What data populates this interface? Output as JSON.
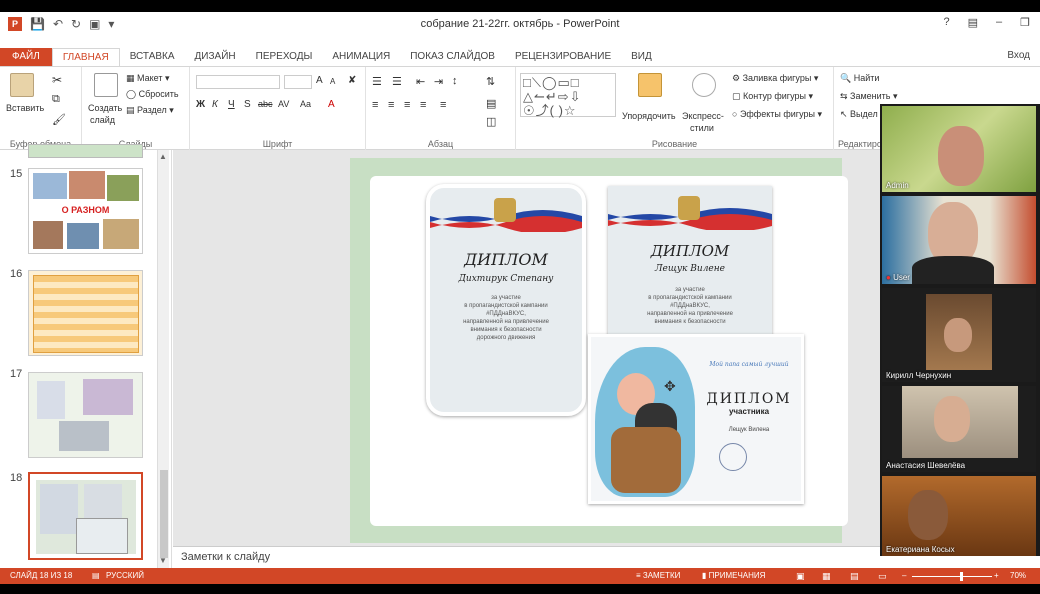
{
  "window": {
    "title": "собрание 21-22гг. октябрь - PowerPoint",
    "help": "?",
    "minimize": "–",
    "signin": "Вход"
  },
  "tabs": [
    "ФАЙЛ",
    "ГЛАВНАЯ",
    "ВСТАВКА",
    "ДИЗАЙН",
    "ПЕРЕХОДЫ",
    "АНИМАЦИЯ",
    "ПОКАЗ СЛАЙДОВ",
    "РЕЦЕНЗИРОВАНИЕ",
    "ВИД"
  ],
  "ribbon": {
    "paste": "Вставить",
    "create_slide": "Создать",
    "create_slide2": "слайд",
    "layout": "Макет",
    "reset": "Сбросить",
    "section": "Раздел",
    "font_bold": "Ж",
    "font_italic": "К",
    "font_underline": "Ч",
    "font_strike": "S",
    "font_abc": "abc",
    "font_av": "AV",
    "font_aa": "Aa",
    "font_a": "A",
    "font_grow": "A",
    "font_shrink": "A",
    "arrange": "Упорядочить",
    "express1": "Экспресс-",
    "express2": "стили",
    "fill": "Заливка фигуры",
    "outline": "Контур фигуры",
    "effects": "Эффекты фигуры",
    "find": "Найти",
    "replace": "Заменить",
    "select": "Выдел",
    "groups": {
      "clipboard": "Буфер обмена",
      "slides": "Слайды",
      "font": "Шрифт",
      "paragraph": "Абзац",
      "drawing": "Рисование",
      "editing": "Редактиро"
    }
  },
  "thumbnails": [
    {
      "num": "15",
      "caption": "О РАЗНОМ"
    },
    {
      "num": "16"
    },
    {
      "num": "17"
    },
    {
      "num": "18"
    }
  ],
  "slide": {
    "diploma1": {
      "title": "ДИПЛОМ",
      "name": "Дихтирук Степану",
      "lines": [
        "за участие",
        "в пропагандистской кампании",
        "#ПДДнаВКУС,",
        "направленной на привлечение",
        "внимания к безопасности",
        "дорожного движения"
      ]
    },
    "diploma2": {
      "title": "ДИПЛОМ",
      "name": "Лещук Вилене",
      "lines": [
        "за участие",
        "в пропагандистской кампании",
        "#ПДДнаВКУС,",
        "направленной на привлечение",
        "внимания к безопасности"
      ]
    },
    "diploma3": {
      "title": "ДИПЛОМ",
      "subtitle": "участника",
      "name": "Лещук Вилена",
      "tagline": "Мой папа самый лучший"
    }
  },
  "notes_placeholder": "Заметки к слайду",
  "status": {
    "slide": "СЛАЙД 18 ИЗ 18",
    "lang": "РУССКИЙ",
    "notes": "ЗАМЕТКИ",
    "comments": "ПРИМЕЧАНИЯ",
    "zoom": "70%",
    "zoom_fraction": 0.6
  },
  "participants": [
    {
      "name": "Admin"
    },
    {
      "name": "User"
    },
    {
      "name": "Кирилл Чернухин"
    },
    {
      "name": "Анастасия Шевелёва"
    },
    {
      "name": "Екатериана Косых"
    }
  ],
  "colors": {
    "accent": "#d24726",
    "slide_bg": "#c8dfc4"
  }
}
